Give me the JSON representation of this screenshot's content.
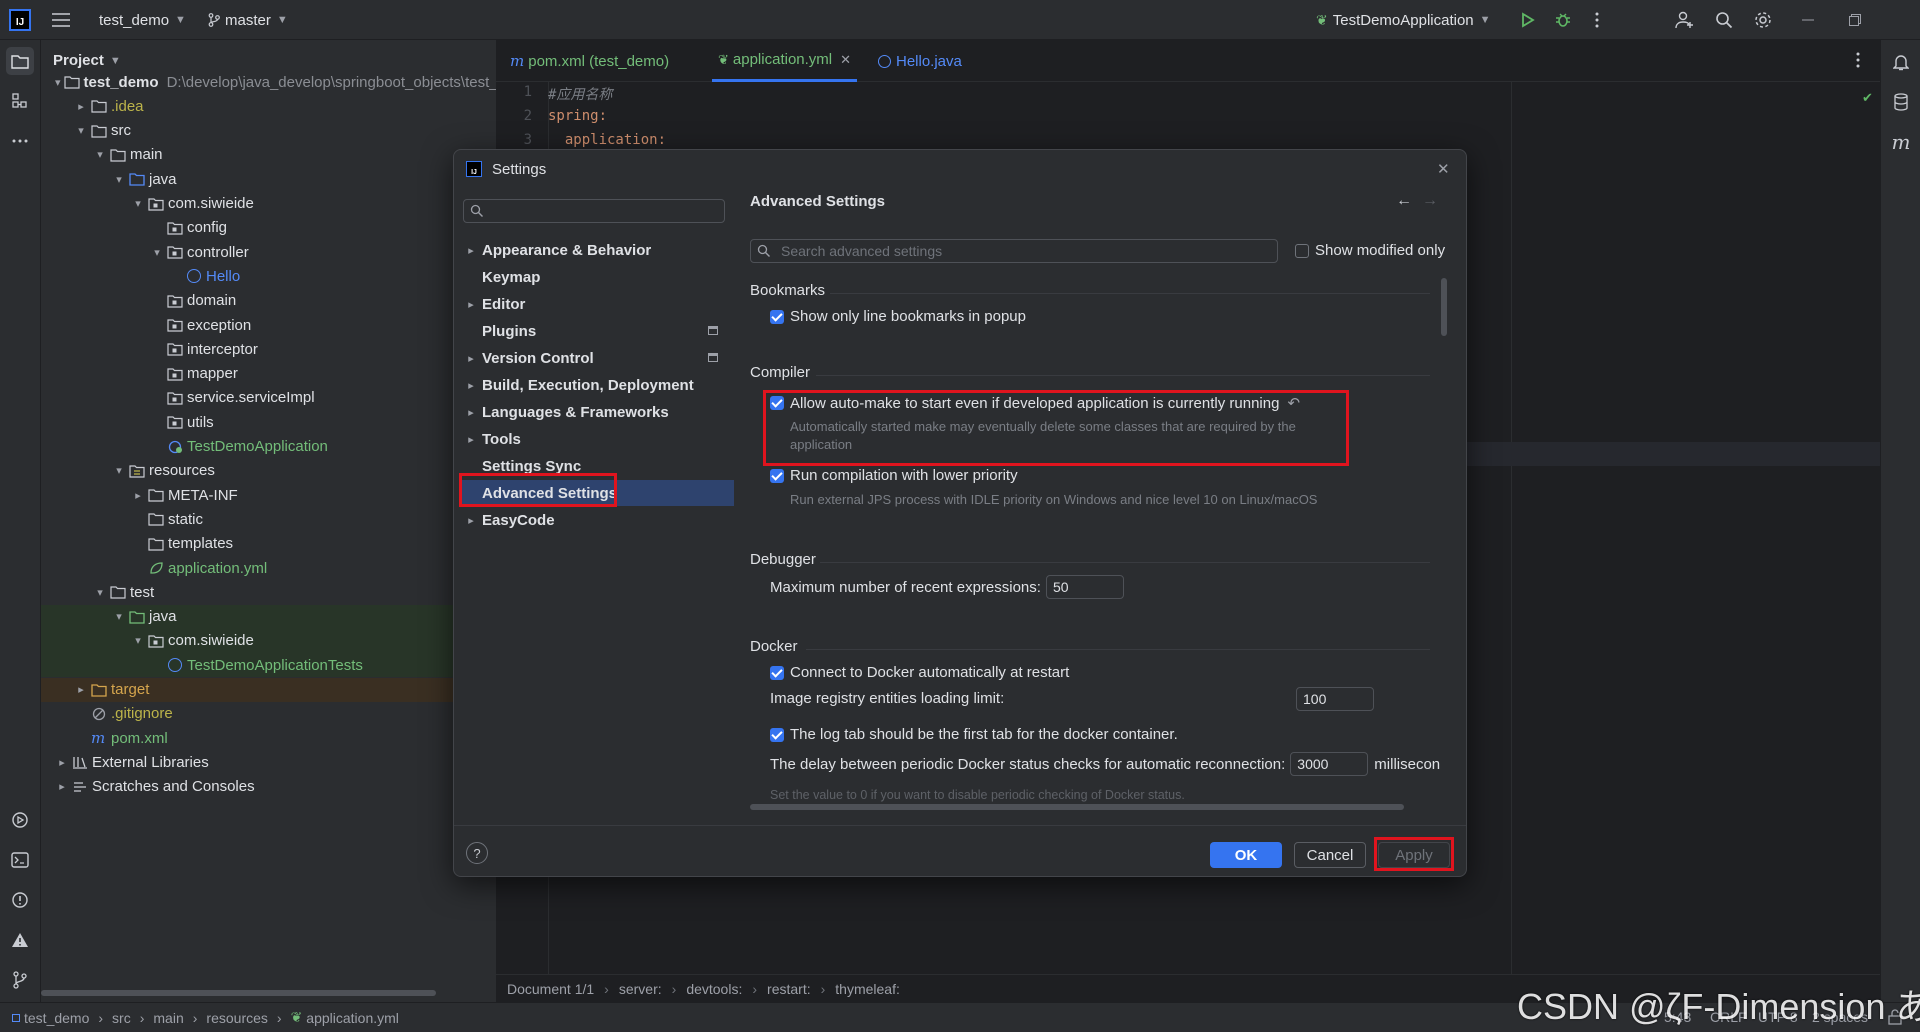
{
  "titlebar": {
    "project": "test_demo",
    "branch": "master",
    "run_config": "TestDemoApplication"
  },
  "project_panel": {
    "title": "Project",
    "rows": [
      {
        "label": "test_demo",
        "path": "D:\\develop\\java_develop\\springboot_objects\\test_demo"
      },
      {
        "label": ".idea"
      },
      {
        "label": "src"
      },
      {
        "label": "main"
      },
      {
        "label": "java"
      },
      {
        "label": "com.siwieide"
      },
      {
        "label": "config"
      },
      {
        "label": "controller"
      },
      {
        "label": "Hello"
      },
      {
        "label": "domain"
      },
      {
        "label": "exception"
      },
      {
        "label": "interceptor"
      },
      {
        "label": "mapper"
      },
      {
        "label": "service.serviceImpl"
      },
      {
        "label": "utils"
      },
      {
        "label": "TestDemoApplication"
      },
      {
        "label": "resources"
      },
      {
        "label": "META-INF"
      },
      {
        "label": "static"
      },
      {
        "label": "templates"
      },
      {
        "label": "application.yml"
      },
      {
        "label": "test"
      },
      {
        "label": "java"
      },
      {
        "label": "com.siwieide"
      },
      {
        "label": "TestDemoApplicationTests"
      },
      {
        "label": "target"
      },
      {
        "label": ".gitignore"
      },
      {
        "label": "pom.xml"
      },
      {
        "label": "External Libraries"
      },
      {
        "label": "Scratches and Consoles"
      }
    ]
  },
  "editor": {
    "tabs": [
      {
        "label": "pom.xml (test_demo)"
      },
      {
        "label": "application.yml"
      },
      {
        "label": "Hello.java"
      }
    ],
    "lines": [
      {
        "no": "1",
        "text": "#应用名称"
      },
      {
        "no": "2",
        "text": "spring:"
      },
      {
        "no": "3",
        "text": "  application:"
      }
    ],
    "breadcrumbs": [
      "Document 1/1",
      "server:",
      "devtools:",
      "restart:",
      "thymeleaf:"
    ]
  },
  "statusbar": {
    "path": [
      "test_demo",
      "src",
      "main",
      "resources",
      "application.yml"
    ],
    "position": "5:43",
    "line_sep": "CRLF",
    "encoding": "UTF-8",
    "indent": "2 spaces",
    "watermark": "CSDN @ζF-Dimension あ"
  },
  "dialog": {
    "title": "Settings",
    "nav": [
      {
        "label": "Appearance & Behavior"
      },
      {
        "label": "Keymap"
      },
      {
        "label": "Editor"
      },
      {
        "label": "Plugins"
      },
      {
        "label": "Version Control"
      },
      {
        "label": "Build, Execution, Deployment"
      },
      {
        "label": "Languages & Frameworks"
      },
      {
        "label": "Tools"
      },
      {
        "label": "Settings Sync"
      },
      {
        "label": "Advanced Settings"
      },
      {
        "label": "EasyCode"
      }
    ],
    "page_title": "Advanced Settings",
    "search_placeholder": "Search advanced settings",
    "show_modified_label": "Show modified only",
    "bookmarks": {
      "title": "Bookmarks",
      "item": "Show only line bookmarks in popup"
    },
    "compiler": {
      "title": "Compiler",
      "automake": "Allow auto-make to start even if developed application is currently running",
      "automake_hint_1": "Automatically started make may eventually delete some classes that are required by the",
      "automake_hint_2": "application",
      "lowprio": "Run compilation with lower priority",
      "lowprio_hint": "Run external JPS process with IDLE priority on Windows and nice level 10 on Linux/macOS"
    },
    "debugger": {
      "title": "Debugger",
      "label": "Maximum number of recent expressions:",
      "value": "50"
    },
    "docker": {
      "title": "Docker",
      "connect": "Connect to Docker automatically at restart",
      "limit_label": "Image registry entities loading limit:",
      "limit_value": "100",
      "logtab": "The log tab should be the first tab for the docker container.",
      "delay_label": "The delay between periodic Docker status checks for automatic reconnection:",
      "delay_value": "3000",
      "delay_unit": "millisecon",
      "delay_hint": "Set the value to 0 if you want to disable periodic checking of Docker status."
    },
    "buttons": {
      "ok": "OK",
      "cancel": "Cancel",
      "apply": "Apply",
      "help": "?"
    }
  }
}
